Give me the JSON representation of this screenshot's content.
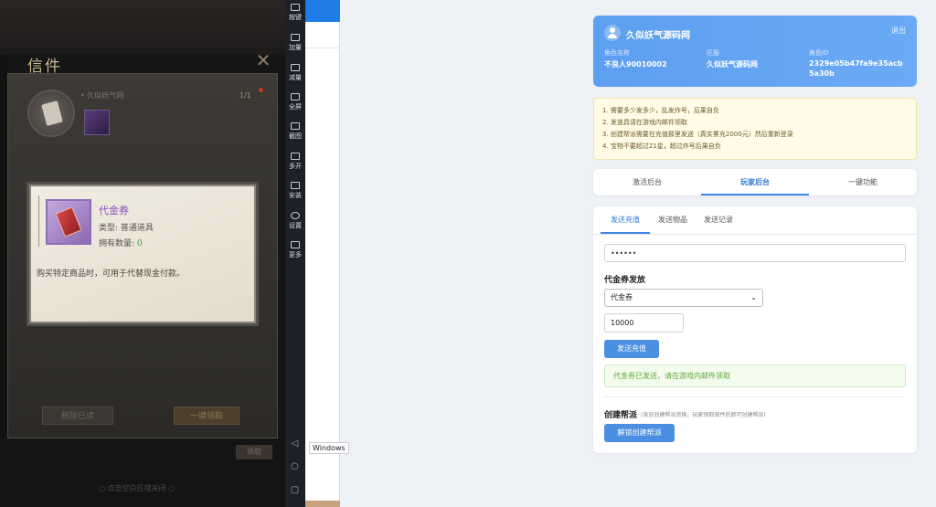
{
  "game": {
    "letter_title": "信件",
    "close_glyph": "✕",
    "mail_sender": "• 久似妖气网",
    "mail_badge": "1/1",
    "delete_label": "删除已读",
    "claim_label": "一键领取",
    "footer_button": "领取",
    "footer_hint": "○ 点击空白区域关闭 ○",
    "tooltip": {
      "item_name": "代金券",
      "type_line": "类型: 普通道具",
      "qty_label": "拥有数量: ",
      "qty_value": "0",
      "description": "购买特定商品时，可用于代替现金付款。"
    }
  },
  "toolbar": {
    "items": [
      {
        "label": "按键",
        "icon": "keyboard-icon"
      },
      {
        "label": "加量",
        "icon": "volume-up-icon"
      },
      {
        "label": "减量",
        "icon": "volume-down-icon"
      },
      {
        "label": "全屏",
        "icon": "fullscreen-icon"
      },
      {
        "label": "截图",
        "icon": "scissors-icon"
      },
      {
        "label": "多开",
        "icon": "multi-window-icon"
      },
      {
        "label": "安装",
        "icon": "install-icon"
      },
      {
        "label": "设置",
        "icon": "gear-icon"
      },
      {
        "label": "更多",
        "icon": "more-icon"
      }
    ],
    "nav": {
      "back": "◁",
      "home": "○",
      "recent": "▢"
    }
  },
  "taskbar_label": "Windows",
  "profile": {
    "site_name": "久似妖气源码网",
    "logout": "退出",
    "fields": [
      {
        "label": "角色名称",
        "value": "不良人90010002"
      },
      {
        "label": "区服",
        "value": "久似妖气源码网"
      },
      {
        "label": "角色ID",
        "value": "2329e05b47fa9e35acb5a30b"
      }
    ]
  },
  "notice": [
    "1. 需要多少发多少，乱发炸号，后果自负",
    "2. 发道具请在游戏内邮件领取",
    "3. 创建帮派需要在充值那里发送（真实累充2000元）然后重新登录",
    "4. 宝物不要超过21星，超过炸号后果自负"
  ],
  "main_tabs": [
    "激活后台",
    "玩家后台",
    "一键功能"
  ],
  "sub_tabs": [
    "发送充值",
    "发送物品",
    "发送记录"
  ],
  "form": {
    "password_value": "••••••",
    "voucher_heading": "代金券发放",
    "item_selected": "代金券",
    "quantity": "10000",
    "send_label": "发送充值",
    "success": "代金券已发送，请在游戏内邮件领取",
    "guild_heading": "创建帮派",
    "guild_note": "(发放创建帮派资格，玩家领取邮件后即可创建帮派)",
    "unlock_label": "解锁创建帮派"
  },
  "colors": {
    "accent": "#4a8fe2",
    "success": "#62a842",
    "notice_bg": "#fffbe6",
    "item_purple": "#8b4ec4"
  }
}
